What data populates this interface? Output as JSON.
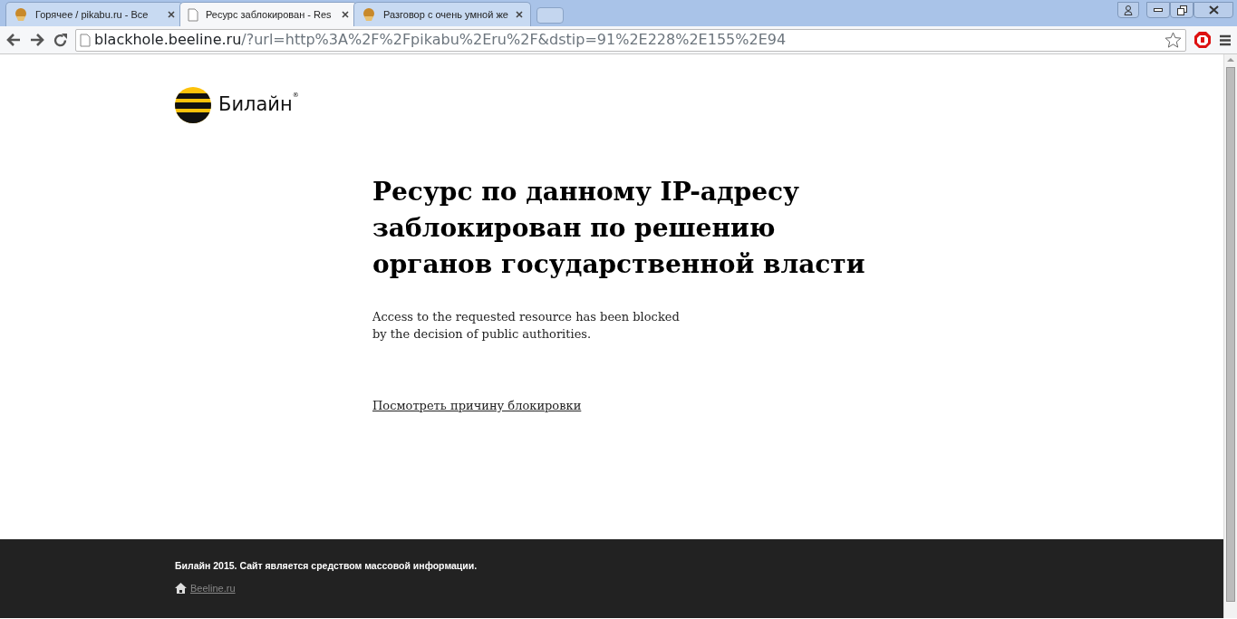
{
  "tabs": [
    {
      "title": "Горячее / pikabu.ru - Все",
      "selected": false
    },
    {
      "title": "Ресурс заблокирован - Res",
      "selected": true
    },
    {
      "title": "Разговор с очень умной же",
      "selected": false
    }
  ],
  "address_bar": {
    "host": "blackhole.beeline.ru",
    "path": "/?url=http%3A%2F%2Fpikabu%2Eru%2F&dstip=91%2E228%2E155%2E94"
  },
  "page": {
    "logo_text": "Билайн",
    "logo_mark": "®",
    "heading": [
      "Ресурс по данному IP-адресу",
      "заблокирован по решению",
      "органов государственной власти"
    ],
    "message": [
      "Access to the requested resource has been blocked",
      "by the decision of public authorities."
    ],
    "link": "Посмотреть причину блокировки"
  },
  "footer": {
    "notice": "Билайн 2015. Сайт является средством массовой информации.",
    "link": "Beeline.ru"
  }
}
